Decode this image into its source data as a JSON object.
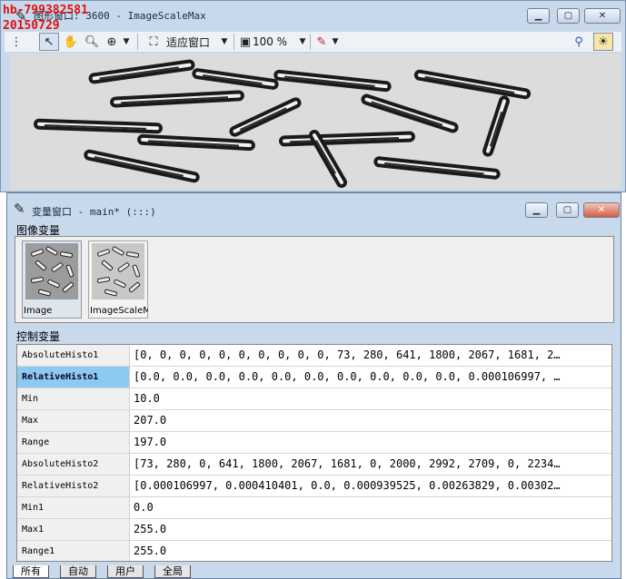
{
  "watermark": {
    "line1": "hb-799382581",
    "line2": "20150729"
  },
  "graphics_window": {
    "title": "图形窗口: 3600 - ImageScaleMax",
    "toolbar": {
      "fit_label": "适应窗口",
      "zoom_label": "100 %"
    }
  },
  "variable_window": {
    "title": "变量窗口 - main* (:::)",
    "image_group_label": "图像变量",
    "images": [
      {
        "label": "Image"
      },
      {
        "label": "ImageScaleMax"
      }
    ],
    "control_group_label": "控制变量",
    "variables": [
      {
        "name": "AbsoluteHisto1",
        "value": "[0, 0, 0, 0, 0, 0, 0, 0, 0, 0, 73, 280, 641, 1800, 2067, 1681, 2…"
      },
      {
        "name": "RelativeHisto1",
        "value": "[0.0, 0.0, 0.0, 0.0, 0.0, 0.0, 0.0, 0.0, 0.0, 0.0, 0.000106997, …"
      },
      {
        "name": "Min",
        "value": "10.0"
      },
      {
        "name": "Max",
        "value": "207.0"
      },
      {
        "name": "Range",
        "value": "197.0"
      },
      {
        "name": "AbsoluteHisto2",
        "value": "[73, 280, 0, 641, 1800, 2067, 1681, 0, 2000, 2992, 2709, 0, 2234…"
      },
      {
        "name": "RelativeHisto2",
        "value": "[0.000106997, 0.000410401, 0.0, 0.000939525, 0.00263829, 0.00302…"
      },
      {
        "name": "Min1",
        "value": "0.0"
      },
      {
        "name": "Max1",
        "value": "255.0"
      },
      {
        "name": "Range1",
        "value": "255.0"
      }
    ],
    "tabs": [
      "所有",
      "自动",
      "用户",
      "全局"
    ]
  }
}
